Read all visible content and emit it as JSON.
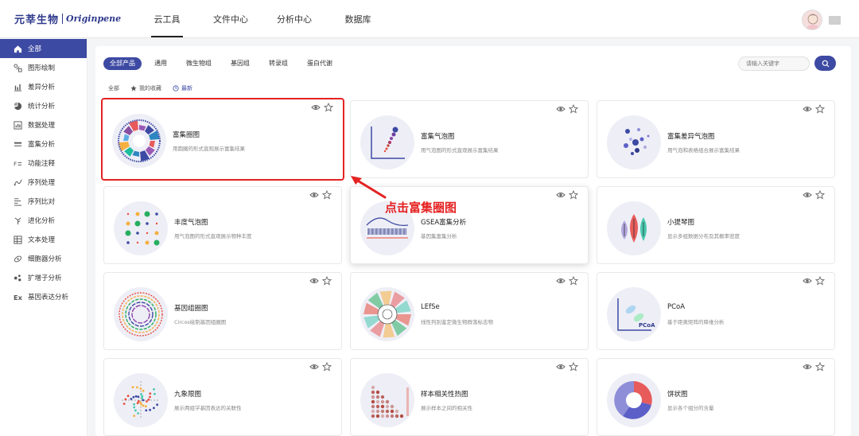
{
  "logo": {
    "cn": "元莘生物",
    "en": "Originpene"
  },
  "nav": [
    {
      "label": "云工具",
      "active": true
    },
    {
      "label": "文件中心"
    },
    {
      "label": "分析中心"
    },
    {
      "label": "数据库"
    }
  ],
  "sidebar": [
    {
      "label": "全部",
      "icon": "home-icon",
      "active": true
    },
    {
      "label": "图形绘制",
      "icon": "shapes-icon"
    },
    {
      "label": "差异分析",
      "icon": "bars-icon"
    },
    {
      "label": "统计分析",
      "icon": "pie-icon"
    },
    {
      "label": "数据处理",
      "icon": "chart-box-icon"
    },
    {
      "label": "富集分析",
      "icon": "layers-icon"
    },
    {
      "label": "功能注释",
      "icon": "annotation-icon"
    },
    {
      "label": "序列处理",
      "icon": "sequence-icon"
    },
    {
      "label": "序列比对",
      "icon": "align-icon"
    },
    {
      "label": "进化分析",
      "icon": "tree-icon"
    },
    {
      "label": "文本处理",
      "icon": "table-icon"
    },
    {
      "label": "细胞器分析",
      "icon": "organelle-icon"
    },
    {
      "label": "扩增子分析",
      "icon": "amplicon-icon"
    },
    {
      "label": "基因表达分析",
      "icon": "ex-icon"
    }
  ],
  "categories": [
    {
      "label": "全部产品",
      "active": true
    },
    {
      "label": "通用"
    },
    {
      "label": "微生物组"
    },
    {
      "label": "基因组"
    },
    {
      "label": "转录组"
    },
    {
      "label": "蛋白代谢"
    }
  ],
  "search": {
    "placeholder": "请输入关键字"
  },
  "filters": [
    {
      "label": "全部"
    },
    {
      "label": "我的收藏",
      "icon": "star-icon"
    },
    {
      "label": "最新",
      "icon": "clock-icon",
      "active": true
    }
  ],
  "tools": [
    {
      "title": "富集圈图",
      "desc": "用圆圈的形式直观展示富集结果",
      "thumb": "circle"
    },
    {
      "title": "富集气泡图",
      "desc": "用气泡图的形式直观展示富集结果",
      "thumb": "bubble"
    },
    {
      "title": "富集差异气泡图",
      "desc": "用气泡和表格组合展示富集结果",
      "thumb": "diffbubble"
    },
    {
      "title": "丰度气泡图",
      "desc": "用气泡图的形式直观展示物种丰度",
      "thumb": "abundance"
    },
    {
      "title": "GSEA富集分析",
      "desc": "基因集富集分析",
      "thumb": "gsea"
    },
    {
      "title": "小提琴图",
      "desc": "显示多组数据分布及其概率密度",
      "thumb": "violin"
    },
    {
      "title": "基因组圈图",
      "desc": "Circos绘制基因组圈图",
      "thumb": "circos"
    },
    {
      "title": "LEfSe",
      "desc": "线性判别鉴定微生物群落标志物",
      "thumb": "lefse"
    },
    {
      "title": "PCoA",
      "desc": "基于距离矩阵的降维分析",
      "thumb": "pcoa",
      "thumb_label": "PCoA"
    },
    {
      "title": "九象限图",
      "desc": "展示两组学基因表达的关联性",
      "thumb": "ninegrid"
    },
    {
      "title": "样本相关性热图",
      "desc": "展示样本之间的相关性",
      "thumb": "heatmap"
    },
    {
      "title": "饼状图",
      "desc": "显示各个组分的含量",
      "thumb": "pie"
    }
  ],
  "callout": {
    "text": "点击富集圈图"
  },
  "colors": {
    "primary": "#3d4aa3",
    "highlight": "#e52222"
  }
}
